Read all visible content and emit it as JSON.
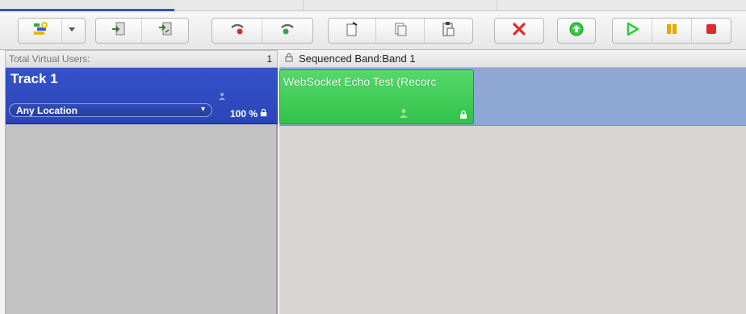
{
  "left_panel": {
    "header_label": "Total Virtual Users:",
    "header_count": "1",
    "track": {
      "name": "Track 1",
      "location": "Any Location",
      "percent": "100 %"
    }
  },
  "right_panel": {
    "header": "Sequenced Band:Band 1",
    "test": {
      "title": "WebSocket Echo Test (Recorc"
    }
  },
  "colors": {
    "track_blue": "#2f4cbf",
    "band_blue": "#8ea7d5",
    "test_green": "#3fcd55",
    "stop_red": "#e02a2a",
    "play_green": "#2ecc40"
  },
  "toolbar_icons": [
    "add-track-icon",
    "dropdown-arrow-icon",
    "import-icon",
    "import-export-icon",
    "record-icon",
    "record-stop-icon",
    "new-script-icon",
    "copy-script-icon",
    "paste-script-icon",
    "delete-icon",
    "upload-icon",
    "play-icon",
    "pause-icon",
    "stop-icon"
  ]
}
